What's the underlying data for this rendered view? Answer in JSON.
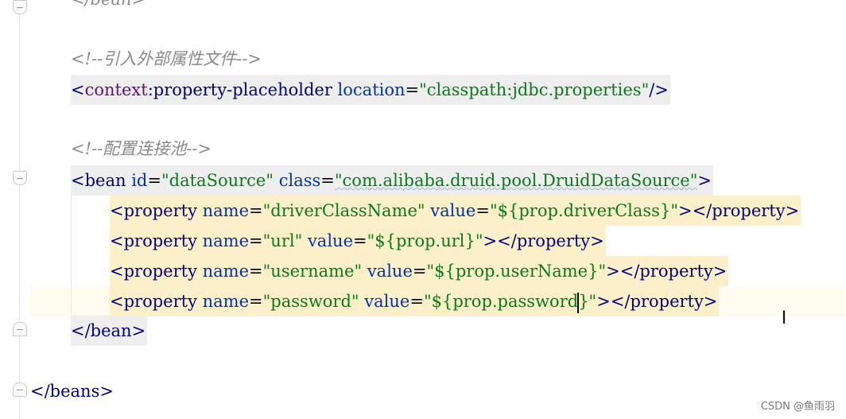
{
  "editor": {
    "partial_top": "</bean>",
    "comment1": "<!--引入外部属性文件-->",
    "placeholder": {
      "open": "<",
      "ns": "context",
      "colon": ":",
      "tag": "property-placeholder",
      "attr": "location",
      "eq": "=",
      "value": "\"classpath:jdbc.properties\"",
      "close": "/>"
    },
    "comment2": "<!--配置连接池-->",
    "bean_open": {
      "open": "<",
      "tag": "bean",
      "attr1": "id",
      "val1": "\"dataSource\"",
      "attr2": "class",
      "val2": "\"com.alibaba.druid.pool.DruidDataSource\"",
      "close": ">"
    },
    "properties": [
      {
        "name": "\"driverClassName\"",
        "value": "\"${prop.driverClass}\""
      },
      {
        "name": "\"url\"",
        "value": "\"${prop.url}\""
      },
      {
        "name": "\"username\"",
        "value": "\"${prop.userName}\""
      },
      {
        "name": "\"password\"",
        "value_before_cursor": "\"${prop.password",
        "value_after_cursor": "}\""
      }
    ],
    "property_tag": "property",
    "name_attr": "name",
    "value_attr": "value",
    "bean_close": "</bean>",
    "beans_close": "</beans>"
  },
  "watermark": "CSDN @鱼雨羽"
}
